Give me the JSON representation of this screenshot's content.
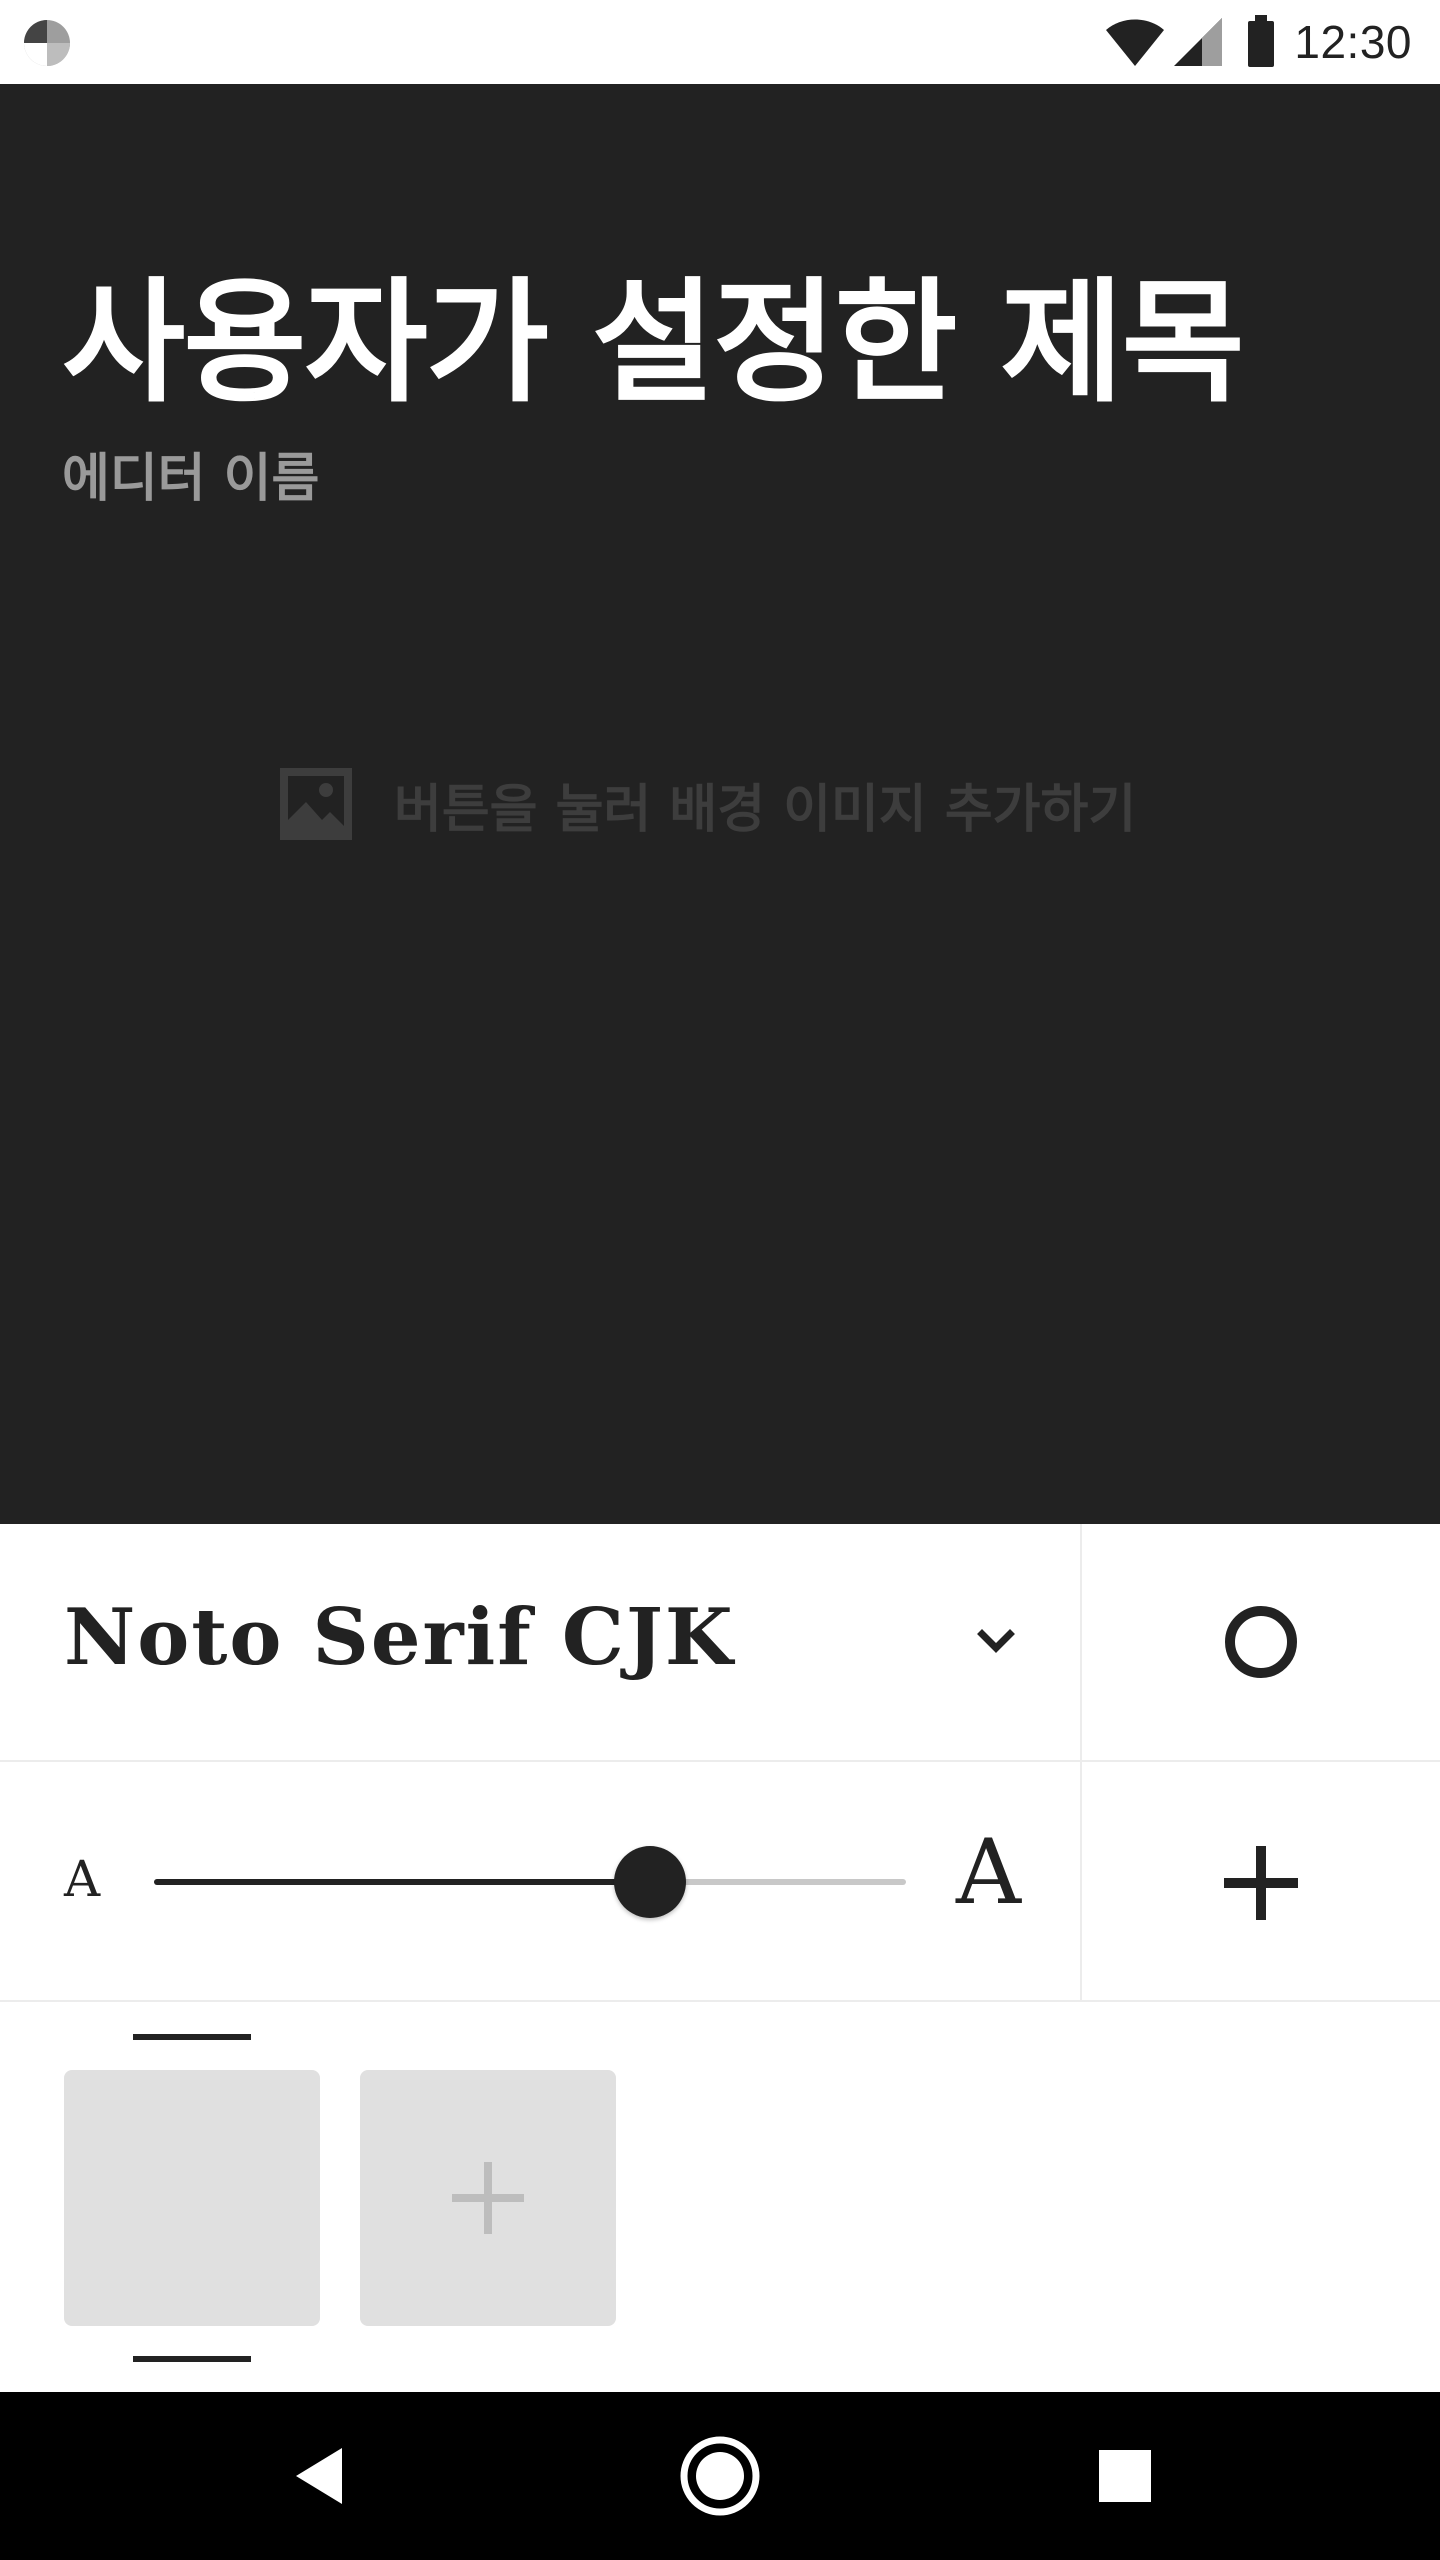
{
  "status_bar": {
    "time": "12:30",
    "icons": [
      "app-notification-icon",
      "wifi-icon",
      "cell-signal-icon",
      "battery-icon"
    ]
  },
  "cover": {
    "title": "사용자가 설정한 제목",
    "editor_name": "에디터 이름",
    "add_background_label": "버튼을 눌러 배경 이미지 추가하기",
    "background_color": "#222222"
  },
  "controls": {
    "font_name": "Noto Serif CJK",
    "size_small_label": "A",
    "size_large_label": "A",
    "font_size_level": 0.66
  },
  "pages": {
    "items": [
      {
        "type": "page",
        "selected": true
      }
    ],
    "add_icon": "plus-icon"
  },
  "nav_bar": {
    "buttons": [
      "back-icon",
      "home-icon",
      "recents-icon"
    ]
  }
}
